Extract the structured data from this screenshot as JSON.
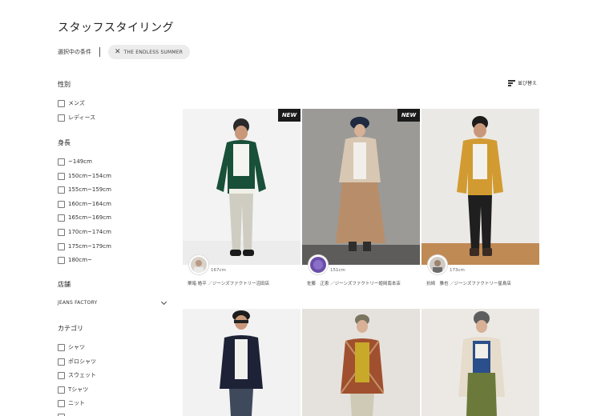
{
  "page": {
    "title": "スタッフスタイリング"
  },
  "conditions": {
    "label": "選択中の条件",
    "chip_label": "THE ENDLESS SUMMER"
  },
  "sort": {
    "label": "並び替え"
  },
  "filters": {
    "gender": {
      "title": "性別",
      "options": [
        "メンズ",
        "レディース"
      ]
    },
    "height": {
      "title": "身長",
      "options": [
        "~149cm",
        "150cm~154cm",
        "155cm~159cm",
        "160cm~164cm",
        "165cm~169cm",
        "170cm~174cm",
        "175cm~179cm",
        "180cm~"
      ]
    },
    "store": {
      "title": "店舗",
      "selected": "JEANS FACTORY"
    },
    "category": {
      "title": "カテゴリ",
      "options": [
        "シャツ",
        "ポロシャツ",
        "スウェット",
        "Tシャツ",
        "ニット"
      ]
    }
  },
  "cards": [
    {
      "badge": "NEW",
      "height": "167cm",
      "staff": "栗暗 皓平 ／ジーンズファクトリー沼田店"
    },
    {
      "badge": "NEW",
      "height": "151cm",
      "staff": "佐藤　正恵 ／ジーンズファクトリー姫岡南本店"
    },
    {
      "badge": "",
      "height": "173cm",
      "staff": "抗崎　雅也 ／ジーンズファクトリー星島店"
    },
    {
      "badge": "",
      "height": "",
      "staff": ""
    },
    {
      "badge": "",
      "height": "",
      "staff": ""
    },
    {
      "badge": "",
      "height": "",
      "staff": ""
    }
  ],
  "colors": {
    "chip_bg": "#ececec",
    "badge_bg": "#1a1a1a",
    "text": "#333333"
  }
}
